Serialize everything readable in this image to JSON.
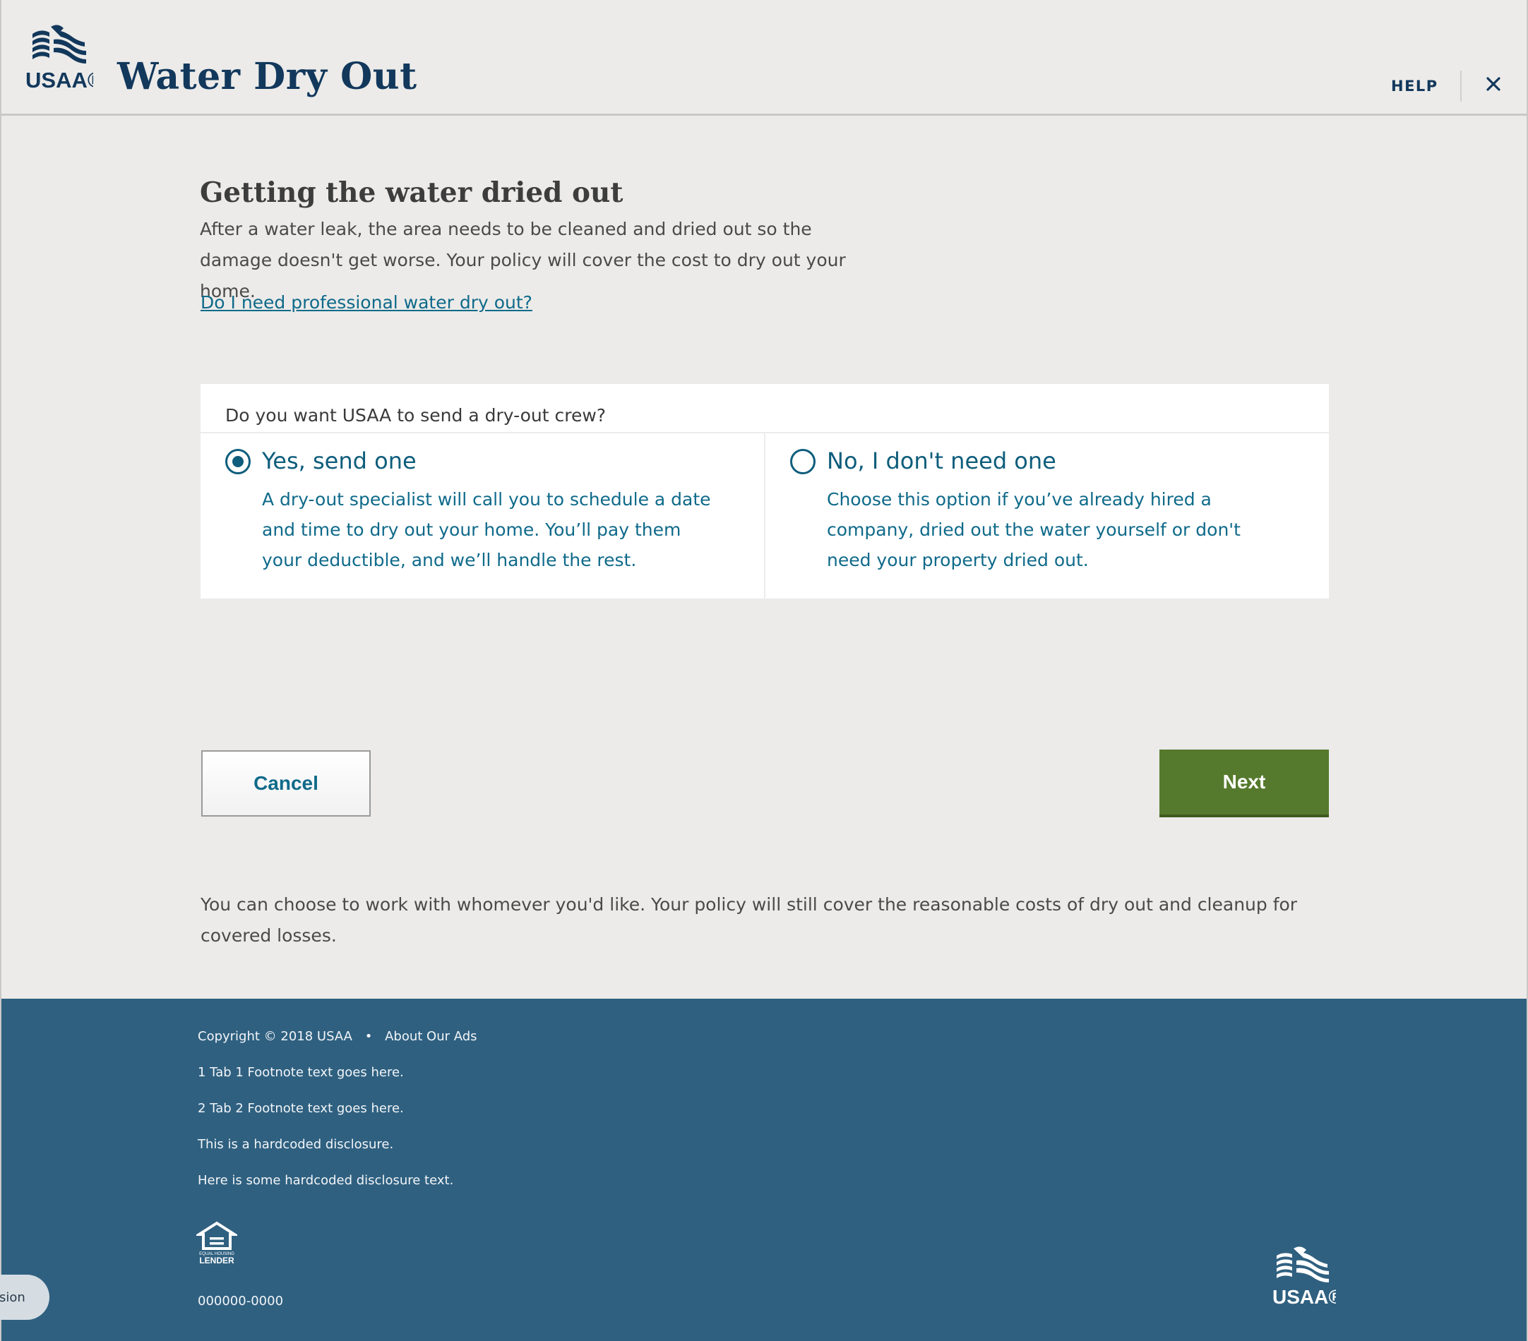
{
  "header": {
    "logo_text": "USAA®",
    "title": "Water Dry Out",
    "help_label": "HELP",
    "close_icon": "close-icon"
  },
  "main": {
    "title": "Getting the water dried out",
    "intro": "After a water leak, the area needs to be cleaned and dried out so the damage doesn't get worse. Your policy will cover the cost to dry out your home.",
    "help_link": "Do I need professional water dry out?",
    "question": "Do you want USAA to send a dry-out crew?",
    "options": [
      {
        "label": "Yes, send one",
        "description": "A dry-out specialist will call you to schedule a date and time to dry out your home. You’ll pay them your deductible, and we’ll handle the rest.",
        "selected": true
      },
      {
        "label": "No, I don't need one",
        "description": "Choose this option if you’ve already hired a company, dried out the water yourself or don't need your property dried out.",
        "selected": false
      }
    ],
    "cancel_label": "Cancel",
    "next_label": "Next",
    "note": "You can choose to work with whomever you'd like. Your policy will still cover the reasonable costs of dry out and cleanup for covered losses."
  },
  "footer": {
    "copyright": "Copyright © 2018 USAA",
    "about_ads": "About Our Ads",
    "footnotes": [
      "1 Tab 1 Footnote text goes here.",
      "2 Tab 2 Footnote text goes here.",
      "This is a hardcoded disclosure.",
      "Here is some hardcoded disclosure text."
    ],
    "equal_housing_text": "EQUAL HOUSING",
    "lender_text": "LENDER",
    "code": "000000-0000",
    "logo_text": "USAA®"
  },
  "side_pill": {
    "label": "ision"
  },
  "colors": {
    "brand_navy": "#12385c",
    "link_teal": "#0f6a8a",
    "next_green": "#567a2d",
    "footer_blue": "#2f6080"
  }
}
